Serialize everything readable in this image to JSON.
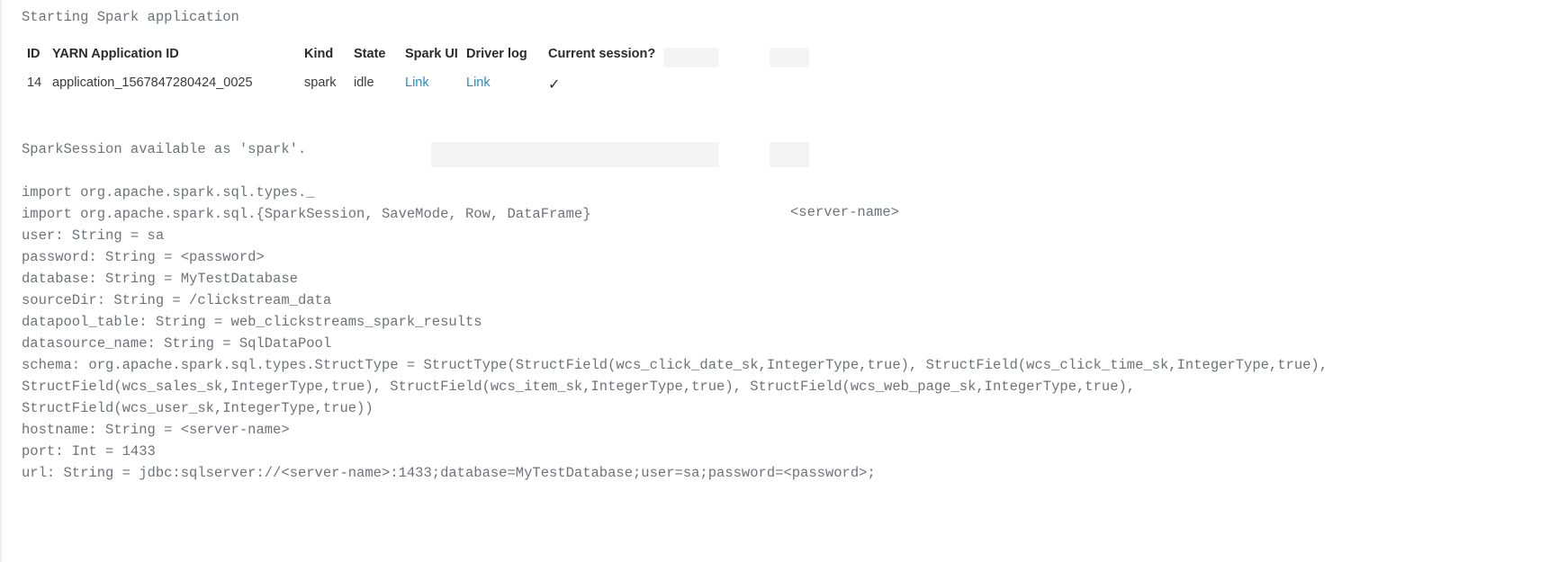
{
  "header": {
    "starting_message": "Starting Spark application"
  },
  "session_table": {
    "columns": [
      "ID",
      "YARN Application ID",
      "Kind",
      "State",
      "Spark UI",
      "Driver log",
      "Current session?"
    ],
    "rows": [
      {
        "id": "14",
        "yarn_application_id": "application_1567847280424_0025",
        "kind": "spark",
        "state": "idle",
        "spark_ui": "Link",
        "driver_log": "Link",
        "current_session": "✓"
      }
    ]
  },
  "colors": {
    "link": "#1e8fd6",
    "log_text": "#6f7277",
    "header_text": "#2b2b2b",
    "background": "#ffffff"
  },
  "output": {
    "lines": [
      "SparkSession available as 'spark'.",
      "",
      "import org.apache.spark.sql.types._",
      "import org.apache.spark.sql.{SparkSession, SaveMode, Row, DataFrame}",
      "user: String = sa",
      "password: String = <password>",
      "database: String = MyTestDatabase",
      "sourceDir: String = /clickstream_data",
      "datapool_table: String = web_clickstreams_spark_results",
      "datasource_name: String = SqlDataPool",
      "schema: org.apache.spark.sql.types.StructType = StructType(StructField(wcs_click_date_sk,IntegerType,true), StructField(wcs_click_time_sk,IntegerType,true),",
      "StructField(wcs_sales_sk,IntegerType,true), StructField(wcs_item_sk,IntegerType,true), StructField(wcs_web_page_sk,IntegerType,true),",
      "StructField(wcs_user_sk,IntegerType,true))",
      "hostname: String = <server-name>",
      "port: Int = 1433",
      "url: String = jdbc:sqlserver://<server-name>:1433;database=MyTestDatabase;user=sa;password=<password>;"
    ],
    "floating_text": "<server-name>"
  }
}
